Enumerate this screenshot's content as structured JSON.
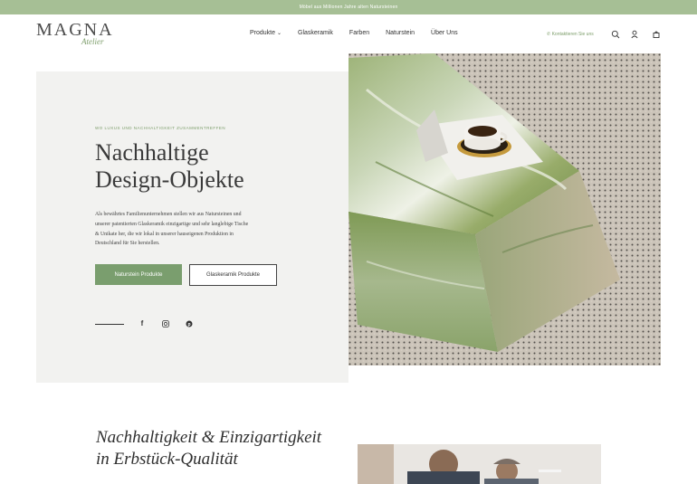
{
  "announcement": "Möbel aus Millionen Jahre alten Natursteinen",
  "brand": {
    "name": "MAGNA",
    "sub": "Atelier"
  },
  "nav": {
    "items": [
      "Produkte",
      "Glaskeramik",
      "Farben",
      "Naturstein",
      "Über Uns"
    ]
  },
  "header": {
    "contact_label": "Kontaktieren Sie uns",
    "icons": [
      "whatsapp-icon",
      "search-icon",
      "account-icon",
      "cart-icon"
    ]
  },
  "hero": {
    "eyebrow": "WO LUXUS UND NACHHALTIGKEIT ZUSAMMENTREFFEN",
    "title_line1": "Nachhaltige",
    "title_line2": "Design-Objekte",
    "text": "Als bewährtes Familienunternehmen stellen wir aus Natursteinen und unserer patentierten Glaskeramik einzigartige und sehr langlebige Tische & Unikate her, die wir lokal in unserer hauseigenen Produktion in Deutschland für Sie herstellen.",
    "primary_button": "Naturstein Produkte",
    "secondary_button": "Glaskeramik Produkte",
    "social": [
      "facebook-icon",
      "instagram-icon",
      "pinterest-icon"
    ]
  },
  "section2": {
    "title_line1": "Nachhaltigkeit & Einzigartigkeit",
    "title_line2": "in Erbstück-Qualität"
  },
  "colors": {
    "accent_green": "#7a9e6e",
    "topbar": "#a6bf95",
    "panel_bg": "#f2f2f0"
  }
}
